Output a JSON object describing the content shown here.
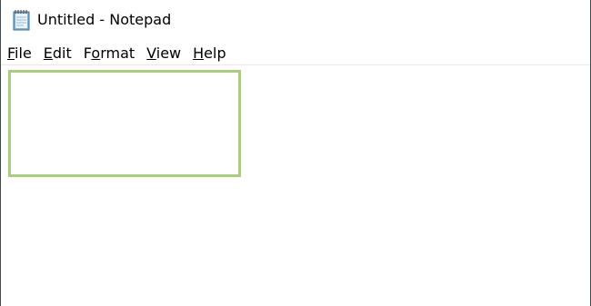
{
  "window": {
    "title": "Untitled - Notepad",
    "icon": "notepad-icon"
  },
  "menu": {
    "items": [
      {
        "mnemonic": "F",
        "rest": "ile"
      },
      {
        "mnemonic": "E",
        "rest": "dit"
      },
      {
        "prefix": "F",
        "mnemonic": "o",
        "rest": "rmat"
      },
      {
        "mnemonic": "V",
        "rest": "iew"
      },
      {
        "mnemonic": "H",
        "rest": "elp"
      }
    ]
  },
  "editor": {
    "content": ""
  },
  "colors": {
    "highlight_border": "#a9cf7c",
    "window_border": "#3f4a55"
  }
}
